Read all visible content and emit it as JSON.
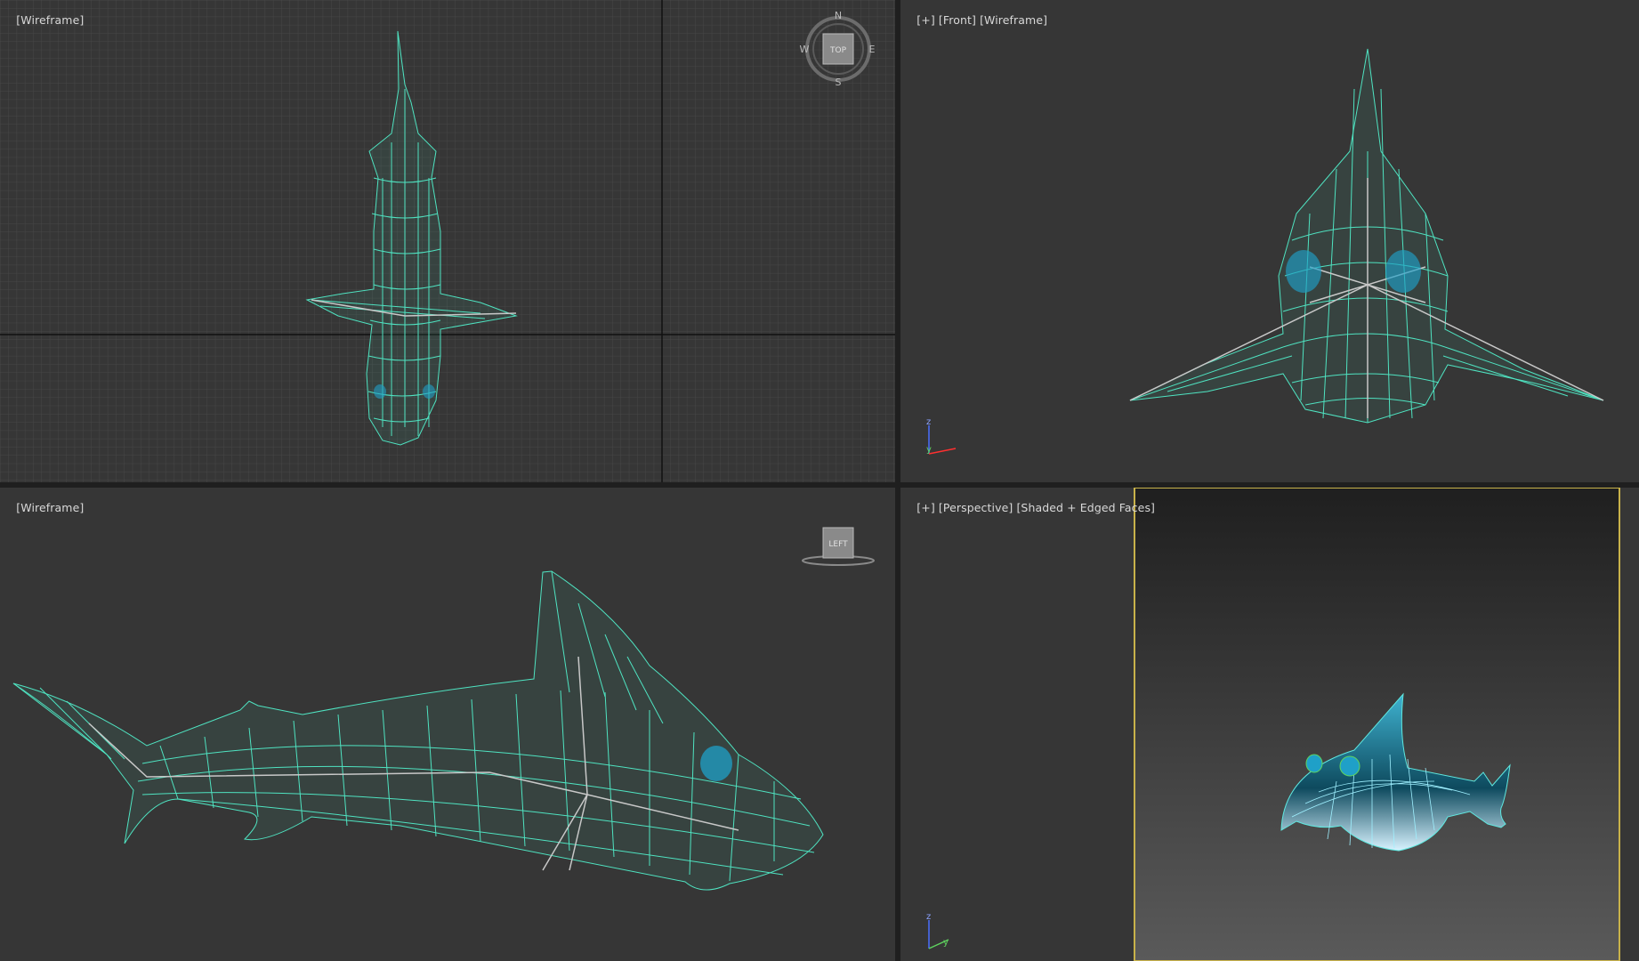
{
  "viewports": {
    "top": {
      "tags": [
        "[Wireframe]"
      ]
    },
    "front": {
      "tags": [
        "[+]",
        "[Front]",
        "[Wireframe]"
      ]
    },
    "left": {
      "tags": [
        "[Wireframe]"
      ]
    },
    "perspective": {
      "tags": [
        "[+]",
        "[Perspective]",
        "[Shaded + Edged Faces]"
      ]
    }
  },
  "viewcube": {
    "top_face": "TOP",
    "left_face": "LEFT",
    "compass": {
      "n": "N",
      "s": "S",
      "e": "E",
      "w": "W"
    }
  },
  "axis_labels": {
    "x": "x",
    "y": "y",
    "z": "z"
  },
  "icons": [
    "viewcube-top-icon",
    "viewcube-left-icon",
    "axis-tripod-icon"
  ],
  "colors": {
    "wireframe": "#4fe3c1",
    "bones": "#c8c8c8",
    "eyes": "#1fa0c8",
    "viewport_bg": "#363636",
    "grid": "#4a4a4a",
    "active_border": "#c8b24a"
  }
}
